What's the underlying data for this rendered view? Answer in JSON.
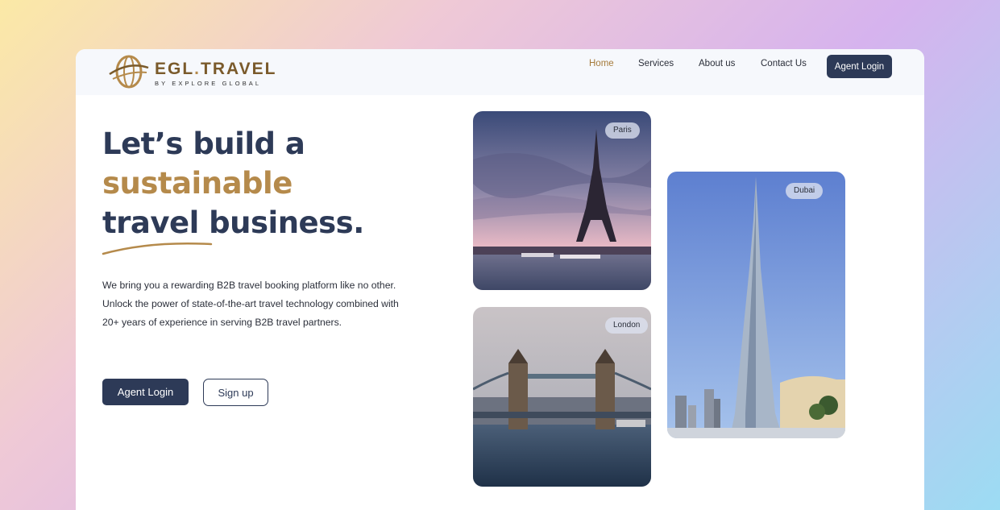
{
  "brand": {
    "name": "EGL",
    "dot": ".",
    "name2": "TRAVEL",
    "tagline": "BY EXPLORE GLOBAL"
  },
  "nav": {
    "items": [
      {
        "label": "Home",
        "active": true
      },
      {
        "label": "Services",
        "active": false
      },
      {
        "label": "About us",
        "active": false
      },
      {
        "label": "Contact Us",
        "active": false
      }
    ],
    "login_label": "Agent Login"
  },
  "hero": {
    "line1": "Let’s build a",
    "line2": "sustainable",
    "line3": "travel business.",
    "description": "We bring you a rewarding B2B travel booking platform like no other. Unlock the power of state-of-the-art travel technology combined with 20+ years of experience in serving B2B travel partners.",
    "primary_button": "Agent Login",
    "secondary_button": "Sign up"
  },
  "destinations": [
    {
      "label": "Paris"
    },
    {
      "label": "London"
    },
    {
      "label": "Dubai"
    }
  ],
  "colors": {
    "navy": "#2d3a57",
    "gold": "#b58a4b",
    "nav_bg": "#f6f8fc"
  }
}
